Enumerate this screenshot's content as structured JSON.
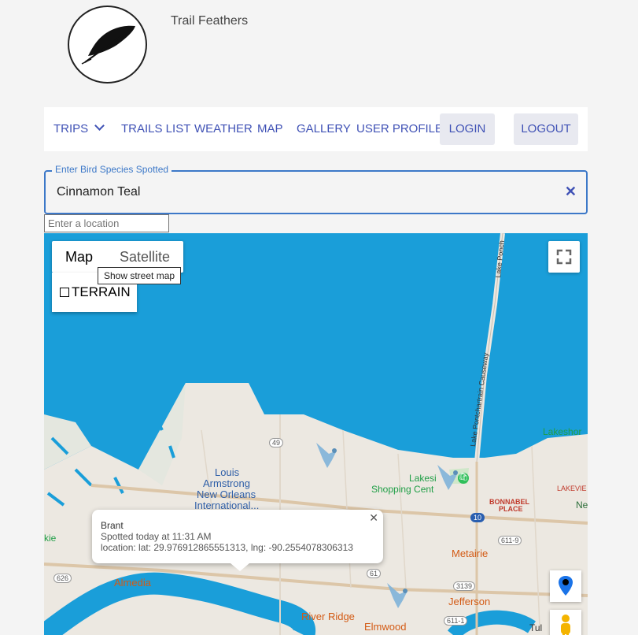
{
  "app": {
    "title": "Trail Feathers"
  },
  "nav": {
    "trips": "TRIPS",
    "trails_list": "TRAILS LIST",
    "weather": "WEATHER",
    "map": "MAP",
    "gallery": "GALLERY",
    "user_profile": "USER PROFILE",
    "login": "LOGIN",
    "logout": "LOGOUT"
  },
  "species_field": {
    "label": "Enter Bird Species Spotted",
    "value": "Cinnamon Teal",
    "clear_icon": "close-icon"
  },
  "location_input": {
    "placeholder": "Enter a location"
  },
  "map": {
    "type_control": {
      "map": "Map",
      "satellite": "Satellite",
      "tooltip": "Show street map",
      "terrain": "TERRAIN"
    },
    "labels": {
      "lake_pontchartrain_1": "Lake Pontchartrain Causeway",
      "lake_pontchartrain_2": "Lake Ponch",
      "lakeshore": "Lakeshor",
      "lakeside_1": "Lakesi",
      "lakeside_2": "Shopping Cent",
      "bonnabel_1": "BONNABEL",
      "bonnabel_2": "PLACE",
      "lakeview": "LAKEVIE",
      "ne": "Ne",
      "airport_1": "Louis",
      "airport_2": "Armstrong",
      "airport_3": "New Orleans",
      "airport_4": "International...",
      "metairie": "Metairie",
      "almedia": "Almedia",
      "river_ridge": "River Ridge",
      "jefferson": "Jefferson",
      "elmwood": "Elmwood",
      "tul": "Tul",
      "kie": "kie",
      "r49": "49",
      "r10": "10",
      "r611": "611-9",
      "r626": "626",
      "r61": "61",
      "r3139": "3139",
      "r6111": "611-1"
    },
    "info_window": {
      "title": "Brant",
      "spotted": "Spotted today at 11:31 AM",
      "location": "location: lat: 29.976912865551313, lng: -90.2554078306313"
    }
  },
  "colors": {
    "nav_text": "#3f51b5",
    "field_border": "#3c78c8",
    "water": "#1a9ed9",
    "land": "#ece8e1"
  }
}
